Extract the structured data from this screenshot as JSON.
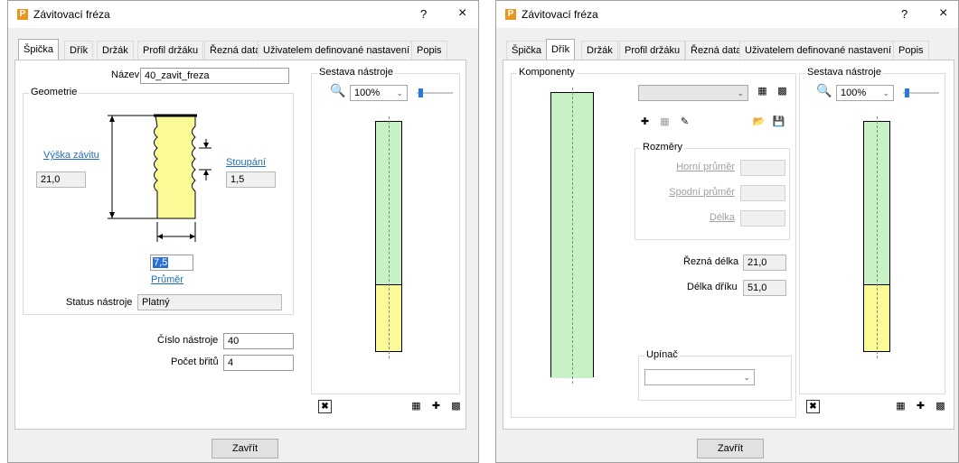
{
  "dialog1": {
    "title": "Závitovací fréza",
    "app_icon": "P",
    "help": "?",
    "close": "×",
    "tabs": [
      "Špička",
      "Dřík",
      "Držák",
      "Profil držáku",
      "Řezná data",
      "Uživatelem definované nastavení",
      "Popis"
    ],
    "active_tab": "Špička",
    "name_label": "Název",
    "name_value": "40_zavit_freza",
    "geometry_group": "Geometrie",
    "thread_height_label": "Výška závitu",
    "thread_height_value": "21,0",
    "pitch_label": "Stoupání",
    "pitch_value": "1,5",
    "diameter_value": "7,5",
    "diameter_label": "Průměr",
    "status_label": "Status nástroje",
    "status_value": "Platný",
    "tool_number_label": "Číslo nástroje",
    "tool_number_value": "40",
    "flutes_label": "Počet břitů",
    "flutes_value": "4",
    "assembly_group": "Sestava nástroje",
    "zoom_value": "100%",
    "close_button": "Zavřít"
  },
  "dialog2": {
    "title": "Závitovací fréza",
    "app_icon": "P",
    "help": "?",
    "close": "×",
    "tabs": [
      "Špička",
      "Dřík",
      "Držák",
      "Profil držáku",
      "Řezná data",
      "Uživatelem definované nastavení",
      "Popis"
    ],
    "active_tab": "Dřík",
    "components_group": "Komponenty",
    "dimensions_group": "Rozměry",
    "upper_diameter_label": "Horní průměr",
    "lower_diameter_label": "Spodní průměr",
    "length_label": "Délka",
    "cutting_length_label": "Řezná délka",
    "cutting_length_value": "21,0",
    "shank_length_label": "Délka dříku",
    "shank_length_value": "51,0",
    "holder_group": "Upínač",
    "assembly_group": "Sestava nástroje",
    "zoom_value": "100%",
    "close_button": "Zavřít"
  },
  "chart_data": null
}
